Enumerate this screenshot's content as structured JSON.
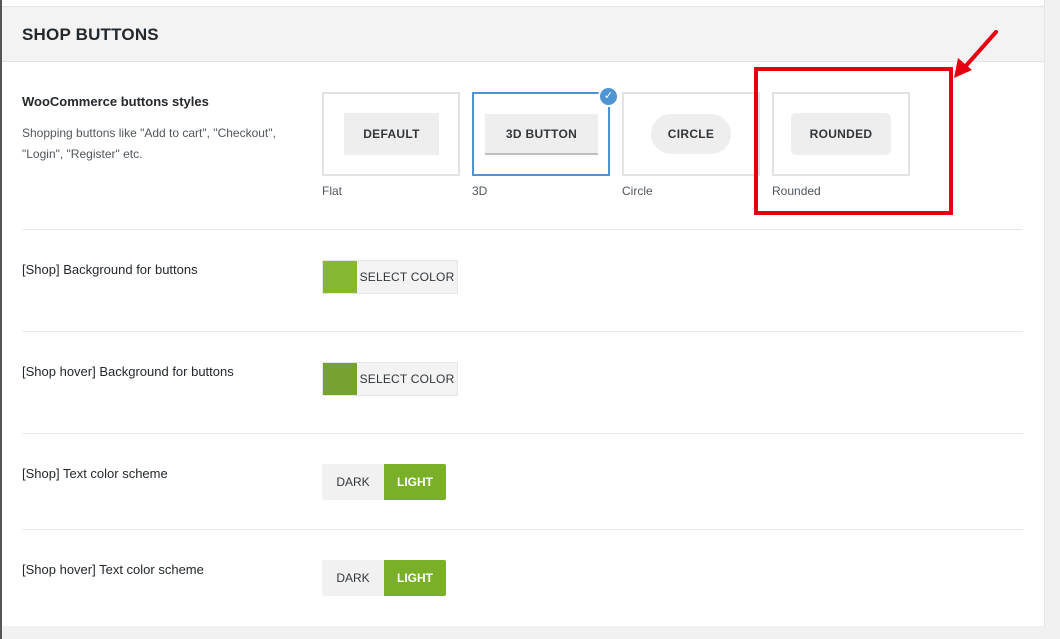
{
  "section": {
    "title": "SHOP BUTTONS"
  },
  "button_styles": {
    "label": "WooCommerce buttons styles",
    "description": "Shopping buttons like \"Add to cart\", \"Checkout\", \"Login\", \"Register\" etc.",
    "selected": "3D",
    "options": [
      {
        "demo_text": "DEFAULT",
        "caption": "Flat"
      },
      {
        "demo_text": "3D BUTTON",
        "caption": "3D"
      },
      {
        "demo_text": "CIRCLE",
        "caption": "Circle"
      },
      {
        "demo_text": "ROUNDED",
        "caption": "Rounded"
      }
    ]
  },
  "shop_bg": {
    "label": "[Shop] Background for buttons",
    "button_label": "SELECT COLOR",
    "color": "#86b833"
  },
  "shop_hover_bg": {
    "label": "[Shop hover] Background for buttons",
    "button_label": "SELECT COLOR",
    "color": "#76a231"
  },
  "shop_text_scheme": {
    "label": "[Shop] Text color scheme",
    "options": [
      "DARK",
      "LIGHT"
    ],
    "selected": "LIGHT"
  },
  "shop_hover_text_scheme": {
    "label": "[Shop hover] Text color scheme",
    "options": [
      "DARK",
      "LIGHT"
    ],
    "selected": "LIGHT"
  },
  "colors": {
    "accent_green": "#7ab028",
    "selected_blue": "#4f94d4",
    "annotation_red": "#e60012"
  }
}
